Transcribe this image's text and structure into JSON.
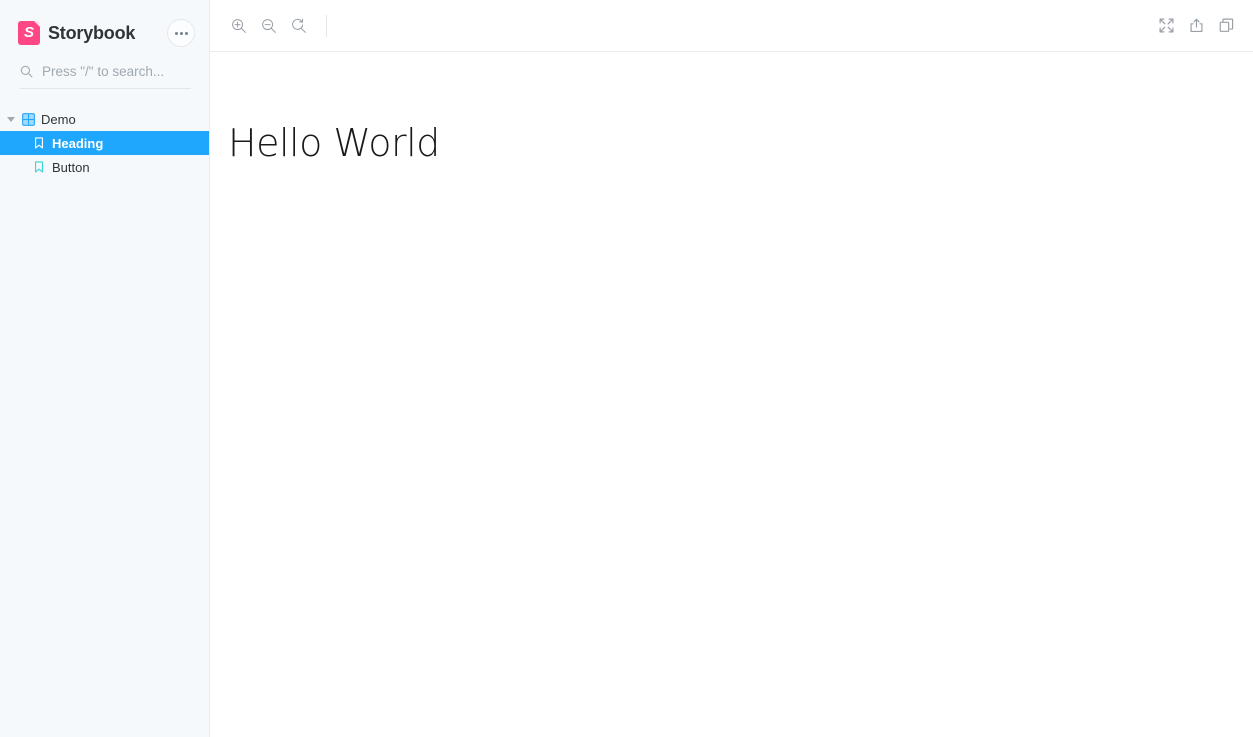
{
  "app": {
    "brand_name": "Storybook",
    "logo_letter": "S",
    "logo_color": "#ff4785",
    "accent_color": "#1ea7fd",
    "story_icon_color": "#37d5d3",
    "component_icon_color": "#1ea7fd",
    "sidebar_bg": "#f6f9fc",
    "canvas_bg": "#ffffff"
  },
  "sidebar": {
    "menu_button_label": "More actions",
    "search": {
      "placeholder": "Press \"/\" to search...",
      "value": "",
      "icon": "search-icon"
    },
    "tree": [
      {
        "id": "demo",
        "label": "Demo",
        "type": "component",
        "icon": "component-grid-icon",
        "depth": 0,
        "expanded": true,
        "selected": false
      },
      {
        "id": "heading",
        "label": "Heading",
        "type": "story",
        "icon": "story-bookmark-icon",
        "depth": 1,
        "expanded": false,
        "selected": true
      },
      {
        "id": "button",
        "label": "Button",
        "type": "story",
        "icon": "story-bookmark-icon",
        "depth": 1,
        "expanded": false,
        "selected": false
      }
    ]
  },
  "toolbar": {
    "left_buttons": [
      {
        "id": "zoom-in",
        "label": "Zoom in",
        "icon": "zoom-in-icon"
      },
      {
        "id": "zoom-out",
        "label": "Zoom out",
        "icon": "zoom-out-icon"
      },
      {
        "id": "zoom-reset",
        "label": "Reset zoom",
        "icon": "zoom-reset-icon"
      }
    ],
    "right_buttons": [
      {
        "id": "fullscreen",
        "label": "Go full screen",
        "icon": "expand-arrows-icon"
      },
      {
        "id": "open-new-tab",
        "label": "Open canvas in new tab",
        "icon": "share-up-icon"
      },
      {
        "id": "copy-link",
        "label": "Copy canvas link",
        "icon": "copy-icon"
      }
    ]
  },
  "canvas": {
    "story_text": "Hello World"
  }
}
